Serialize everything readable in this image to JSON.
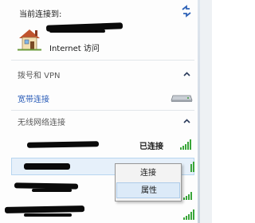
{
  "current": {
    "label": "当前连接到:",
    "network_name": "",
    "access": "Internet 访问"
  },
  "dialup": {
    "title": "拨号和 VPN",
    "item": "宽带连接"
  },
  "wireless": {
    "title": "无线网络连接",
    "status": "已连接"
  },
  "context_menu": {
    "connect": "连接",
    "properties": "属性"
  }
}
